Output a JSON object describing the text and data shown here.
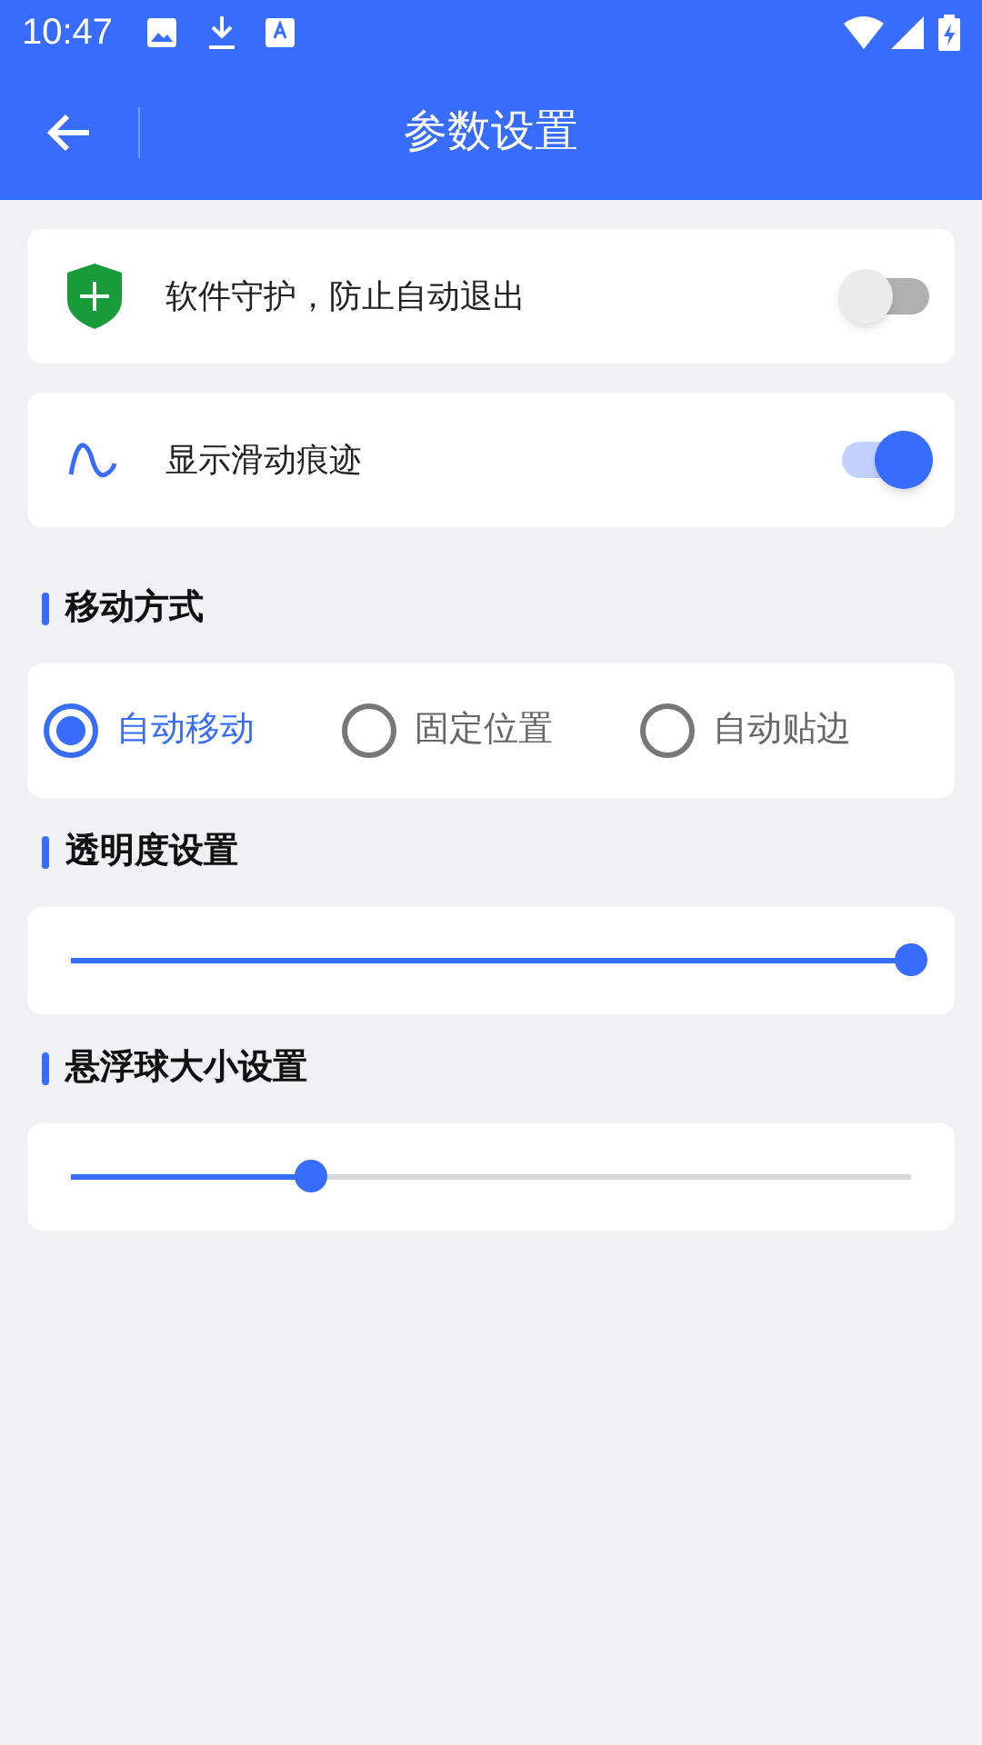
{
  "status_bar": {
    "time": "10:47"
  },
  "app_bar": {
    "title": "参数设置"
  },
  "toggles": [
    {
      "kind": "shield",
      "label": "软件守护，防止自动退出",
      "on": false
    },
    {
      "kind": "wave",
      "label": "显示滑动痕迹",
      "on": true
    }
  ],
  "move_mode": {
    "heading": "移动方式",
    "options": [
      {
        "label": "自动移动",
        "selected": true
      },
      {
        "label": "固定位置",
        "selected": false
      },
      {
        "label": "自动贴边",
        "selected": false
      }
    ]
  },
  "sliders": [
    {
      "heading": "透明度设置",
      "level": 1.0
    },
    {
      "heading": "悬浮球大小设置",
      "level": 0.286
    }
  ]
}
